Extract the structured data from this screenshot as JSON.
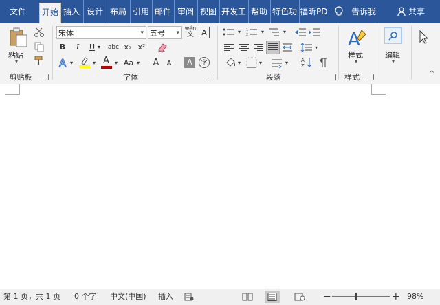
{
  "tabs": [
    {
      "label": "文件"
    },
    {
      "label": "开始"
    },
    {
      "label": "插入"
    },
    {
      "label": "设计"
    },
    {
      "label": "布局"
    },
    {
      "label": "引用"
    },
    {
      "label": "邮件"
    },
    {
      "label": "审阅"
    },
    {
      "label": "视图"
    },
    {
      "label": "开发工"
    },
    {
      "label": "帮助"
    },
    {
      "label": "特色功"
    },
    {
      "label": "福昕PD"
    }
  ],
  "tell_me": "告诉我",
  "share": "共享",
  "clipboard": {
    "paste": "粘贴",
    "group": "剪贴板"
  },
  "font": {
    "name": "宋体",
    "size": "五号",
    "wen": "wén",
    "wen2": "文",
    "bold": "B",
    "italic": "I",
    "underline": "U",
    "strike": "abc",
    "sub": "x₂",
    "sup": "x²",
    "aa": "Aa",
    "grow": "A",
    "shrink": "A",
    "char_border": "A",
    "circle": "字",
    "group": "字体"
  },
  "paragraph": {
    "group": "段落"
  },
  "styles": {
    "label": "样式",
    "group": "样式"
  },
  "editing": {
    "label": "编辑"
  },
  "status": {
    "page": "第 1 页，共 1 页",
    "words": "0 个字",
    "lang": "中文(中国)",
    "insert": "插入",
    "zoom": "98%"
  },
  "colors": {
    "accent": "#2b579a",
    "font_color": "#c00000",
    "highlight": "#ffff00"
  }
}
